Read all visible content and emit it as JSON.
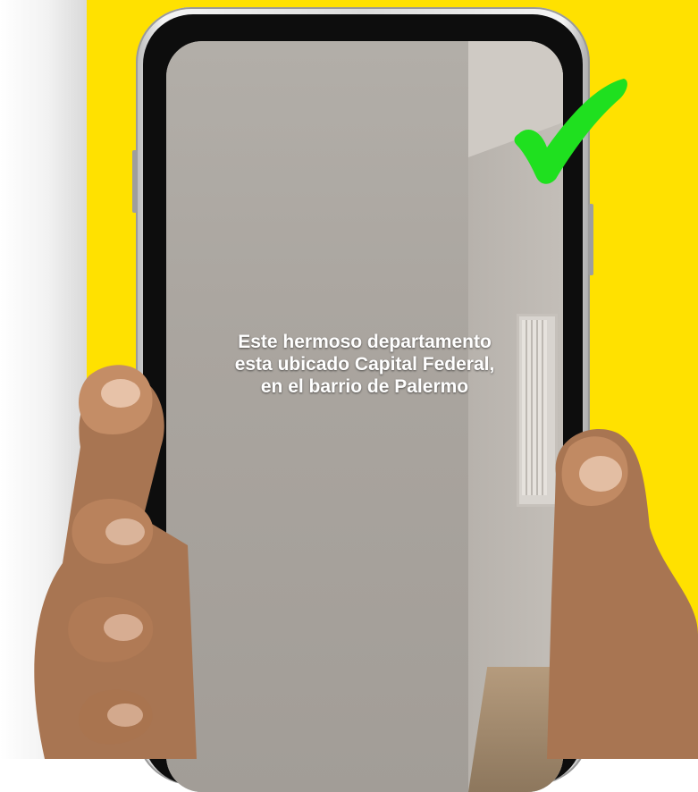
{
  "caption": {
    "line1": "Este hermoso departamento",
    "line2": "esta ubicado Capital Federal,",
    "line3": "en el barrio de Palermo"
  },
  "icons": {
    "check": "checkmark-icon"
  },
  "colors": {
    "background_accent": "#ffe100",
    "checkmark": "#1fe01f",
    "caption_text": "#ffffff"
  }
}
